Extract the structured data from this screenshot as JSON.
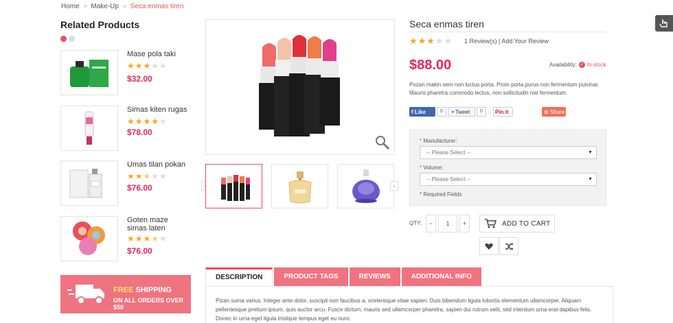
{
  "breadcrumb": {
    "items": [
      "Home",
      "Make-Up"
    ],
    "current": "Seca enmas tiren",
    "separator": ">"
  },
  "related": {
    "title": "Related Products",
    "items": [
      {
        "name": "Mase pola taki",
        "rating": 3,
        "price": "$32.00"
      },
      {
        "name": "Simas kiten rugas",
        "rating": 4,
        "price": "$78.00"
      },
      {
        "name": "Umas tilan pokan",
        "rating": 2.5,
        "price": "$76.00"
      },
      {
        "name": "Goten maze simas laten",
        "rating": 3.5,
        "price": "$76.00"
      }
    ]
  },
  "shipping": {
    "highlight": "FREE",
    "line1": "SHIPPING",
    "line2": "ON ALL ORDERS OVER $50"
  },
  "gallery": {
    "thumbs": [
      "lipsticks",
      "perfume-gold",
      "perfume-purple"
    ],
    "active_thumb": 0
  },
  "product": {
    "title": "Seca enmas tiren",
    "rating": 3,
    "reviews_text": "1 Review(s) | Add Your Review",
    "price": "$88.00",
    "availability_label": "Availability:",
    "availability_value": "In stock",
    "description": "Pozan makin sem non luctus porta. Proin porta purus non fermentum pulvinar. Mauris pharetra commodo lectus, non sollicitudin nisl fermentum."
  },
  "social": {
    "like": "Like",
    "like_count": "0",
    "tweet": "Tweet",
    "tweet_count": "0",
    "pin": "Pin it",
    "share": "Share"
  },
  "options": {
    "manufacturer_label": "Manufacturer:",
    "manufacturer_value": "-- Please Select --",
    "volume_label": "Volume:",
    "volume_value": "-- Please Select --",
    "required_note": "* Required Fields",
    "required_mark": "*"
  },
  "cart": {
    "qty_label": "QTY:",
    "qty_value": "1",
    "minus": "−",
    "plus": "+",
    "add_label": "ADD TO CART"
  },
  "tabs": {
    "items": [
      "DESCRIPTION",
      "PRODUCT TAGS",
      "REVIEWS",
      "ADDITIONAL INFO"
    ],
    "active": 0,
    "content": "Pizan suma varius. Integer ante dolor, suscipit non faucibus a, scelerisque vitae sapien. Duis bibendum ligula lobortis elementum ullamcorper. Aliquam pellentesque pretium ipsum, quis auctor arcu. Fusce dictum, mauris sed ullamcorper pharetra, sapien dui rutrum velit, sed interdum urna erat dapibus felis. Donec in urna eget ligula tristique tempus eget eu nunc."
  },
  "colors": {
    "accent": "#e8505b",
    "price": "#e8265d",
    "tab_bg": "#f07380",
    "star": "#f5a623"
  }
}
